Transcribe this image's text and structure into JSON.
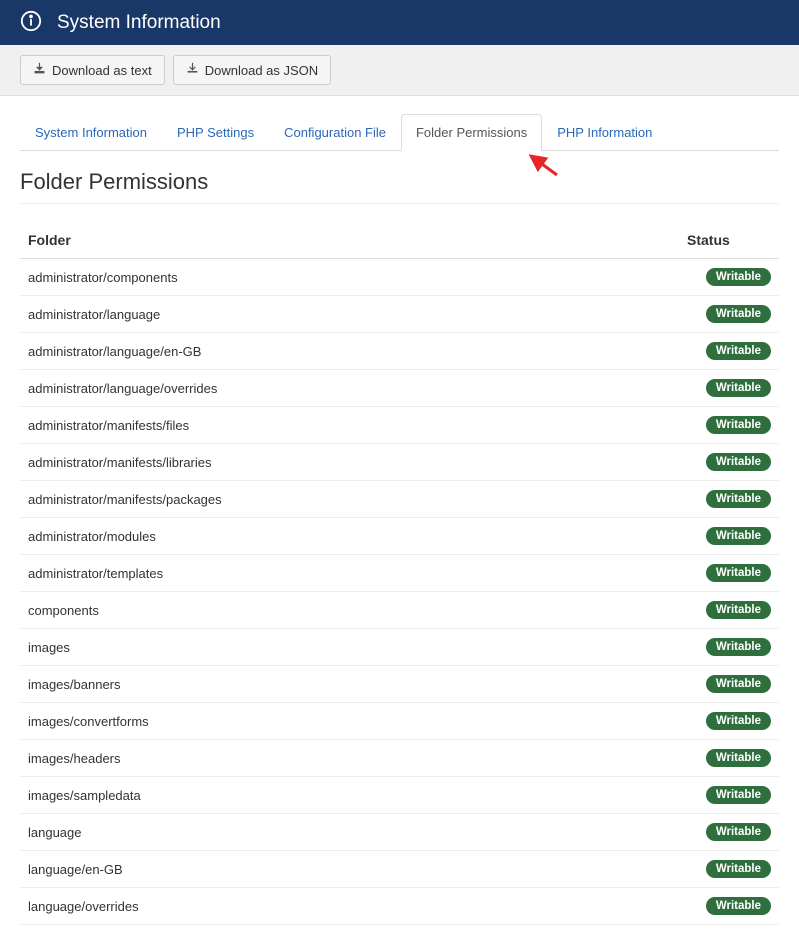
{
  "header": {
    "title": "System Information"
  },
  "toolbar": {
    "download_text": "Download as text",
    "download_json": "Download as JSON"
  },
  "tabs": [
    {
      "label": "System Information",
      "active": false
    },
    {
      "label": "PHP Settings",
      "active": false
    },
    {
      "label": "Configuration File",
      "active": false
    },
    {
      "label": "Folder Permissions",
      "active": true
    },
    {
      "label": "PHP Information",
      "active": false
    }
  ],
  "page": {
    "title": "Folder Permissions"
  },
  "table": {
    "columns": {
      "folder": "Folder",
      "status": "Status"
    },
    "rows": [
      {
        "folder": "administrator/components",
        "status": "Writable"
      },
      {
        "folder": "administrator/language",
        "status": "Writable"
      },
      {
        "folder": "administrator/language/en-GB",
        "status": "Writable"
      },
      {
        "folder": "administrator/language/overrides",
        "status": "Writable"
      },
      {
        "folder": "administrator/manifests/files",
        "status": "Writable"
      },
      {
        "folder": "administrator/manifests/libraries",
        "status": "Writable"
      },
      {
        "folder": "administrator/manifests/packages",
        "status": "Writable"
      },
      {
        "folder": "administrator/modules",
        "status": "Writable"
      },
      {
        "folder": "administrator/templates",
        "status": "Writable"
      },
      {
        "folder": "components",
        "status": "Writable"
      },
      {
        "folder": "images",
        "status": "Writable"
      },
      {
        "folder": "images/banners",
        "status": "Writable"
      },
      {
        "folder": "images/convertforms",
        "status": "Writable"
      },
      {
        "folder": "images/headers",
        "status": "Writable"
      },
      {
        "folder": "images/sampledata",
        "status": "Writable"
      },
      {
        "folder": "language",
        "status": "Writable"
      },
      {
        "folder": "language/en-GB",
        "status": "Writable"
      },
      {
        "folder": "language/overrides",
        "status": "Writable"
      }
    ]
  },
  "colors": {
    "header_bg": "#1a3867",
    "link": "#2a69b8",
    "badge_bg": "#2f6f3e",
    "arrow": "#e8262a"
  }
}
